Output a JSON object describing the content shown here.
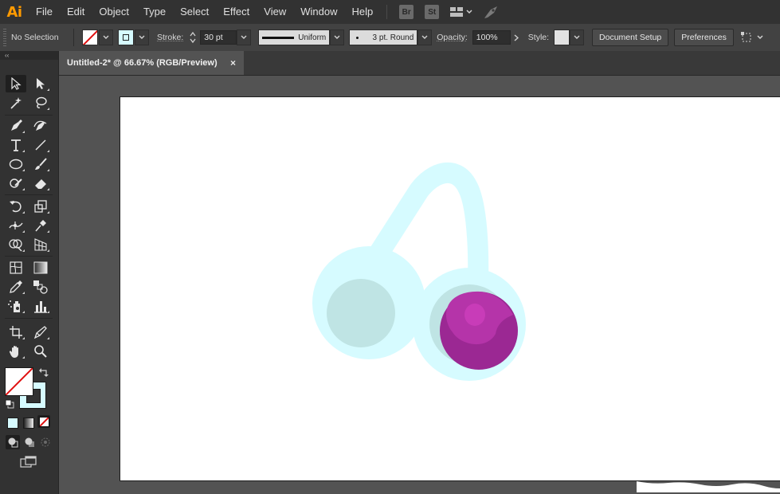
{
  "app": {
    "logo": "Ai"
  },
  "menu": [
    "File",
    "Edit",
    "Object",
    "Type",
    "Select",
    "Effect",
    "View",
    "Window",
    "Help"
  ],
  "menu_badges": {
    "bridge": "Br",
    "stock": "St"
  },
  "control_bar": {
    "selection_status": "No Selection",
    "stroke_label": "Stroke:",
    "stroke_weight": "30 pt",
    "stroke_profile": "Uniform",
    "brush": "3 pt. Round",
    "opacity_label": "Opacity:",
    "opacity_value": "100%",
    "style_label": "Style:",
    "document_setup": "Document Setup",
    "preferences": "Preferences"
  },
  "document": {
    "tab_title": "Untitled-2* @ 66.67% (RGB/Preview)",
    "close_symbol": "×"
  },
  "toolbar": {
    "collapse": "‹‹"
  },
  "colors": {
    "headphone_band": "#d6fbff",
    "ear_pad": "#bfe4e4",
    "grape": "#9b2893",
    "grape_highlight": "#c83cb8",
    "stroke_swatch": "#d6fbff",
    "fill_none_line": "#e01010"
  },
  "icons": {
    "selection": "selection-arrow-icon",
    "direct_selection": "direct-selection-icon",
    "magic_wand": "magic-wand-icon",
    "lasso": "lasso-icon",
    "pen": "pen-icon",
    "curvature": "curvature-pen-icon",
    "type": "type-icon",
    "line": "line-segment-icon",
    "ellipse": "ellipse-icon",
    "paintbrush": "paintbrush-icon",
    "shaper": "shaper-icon",
    "eraser": "eraser-icon",
    "rotate": "rotate-icon",
    "scale": "scale-icon",
    "width": "width-icon",
    "puppet_warp": "puppet-warp-icon",
    "shape_builder": "shape-builder-icon",
    "perspective": "perspective-grid-icon",
    "mesh": "mesh-icon",
    "gradient": "gradient-icon",
    "eyedropper": "eyedropper-icon",
    "blend": "blend-icon",
    "symbol_sprayer": "symbol-sprayer-icon",
    "graph": "column-graph-icon",
    "artboard": "artboard-icon",
    "slice": "slice-icon",
    "hand": "hand-icon",
    "zoom": "zoom-icon"
  }
}
